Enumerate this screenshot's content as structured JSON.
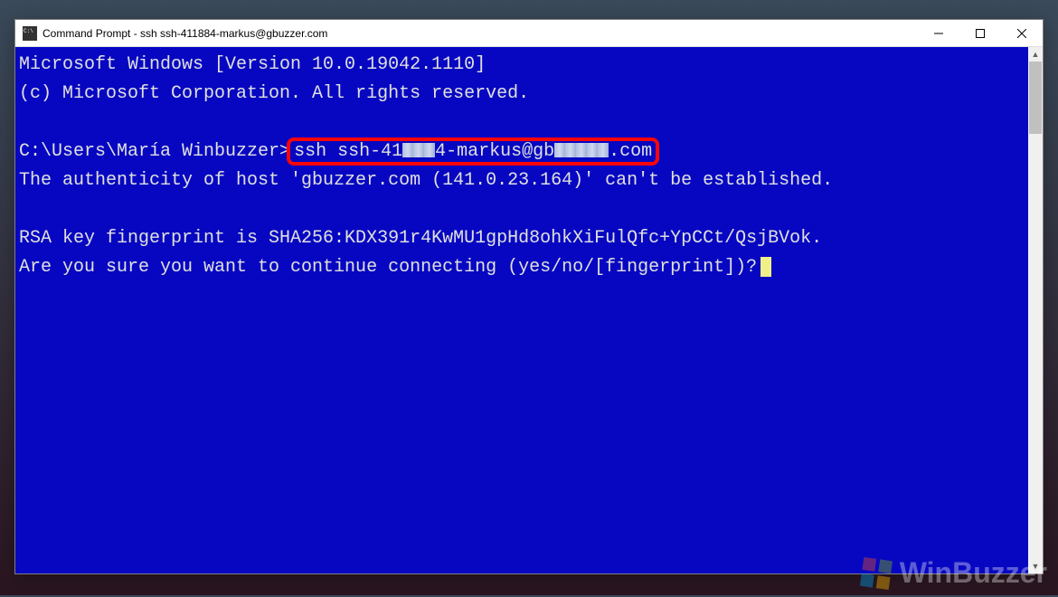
{
  "window": {
    "title": "Command Prompt - ssh  ssh-411884-markus@gbuzzer.com"
  },
  "terminal": {
    "line1": "Microsoft Windows [Version 10.0.19042.1110]",
    "line2": "(c) Microsoft Corporation. All rights reserved.",
    "prompt_path": "C:\\Users\\María Winbuzzer>",
    "ssh_cmd_prefix": "ssh ssh-41",
    "ssh_cmd_obs1": "188",
    "ssh_cmd_mid": "4-markus@gb",
    "ssh_cmd_obs2": "uzzer",
    "ssh_cmd_suffix": ".com",
    "line4": "The authenticity of host 'gbuzzer.com (141.0.23.164)' can't be established.",
    "line5": "RSA key fingerprint is SHA256:KDX391r4KwMU1gpHd8ohkXiFulQfc+YpCCt/QsjBVok.",
    "line6": "Are you sure you want to continue connecting (yes/no/[fingerprint])?"
  },
  "watermark": {
    "text": "WinBuzzer"
  }
}
